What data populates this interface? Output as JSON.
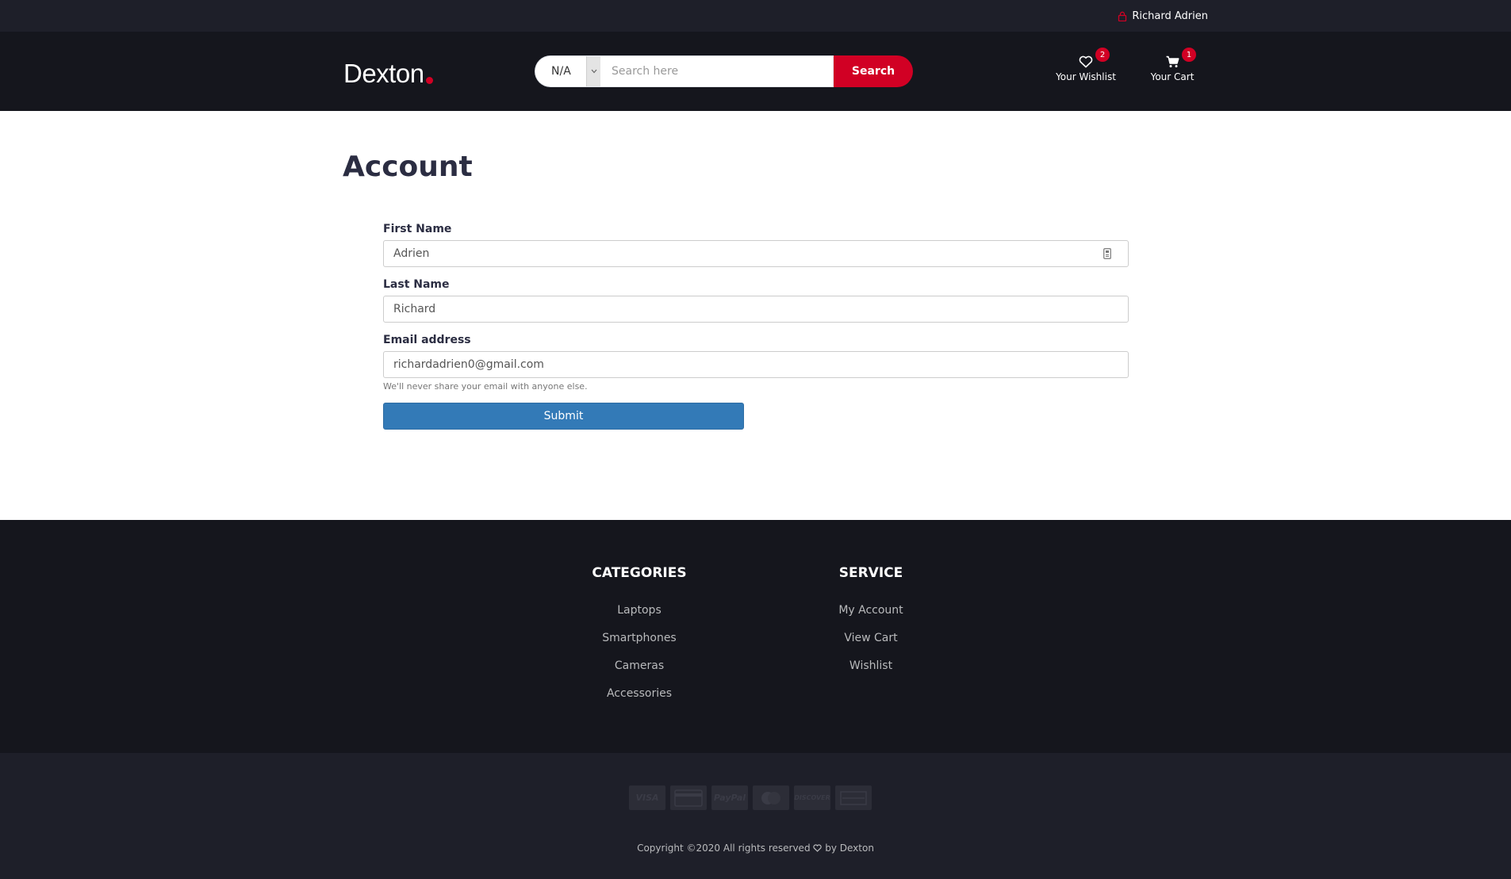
{
  "topbar": {
    "user_name": "Richard Adrien"
  },
  "header": {
    "logo": "Dexton",
    "search": {
      "category_value": "N/A",
      "placeholder": "Search here",
      "button_label": "Search"
    },
    "wishlist": {
      "label": "Your Wishlist",
      "count": "2"
    },
    "cart": {
      "label": "Your Cart",
      "count": "1"
    }
  },
  "main": {
    "title": "Account",
    "form": {
      "first_name_label": "First Name",
      "first_name_value": "Adrien",
      "last_name_label": "Last Name",
      "last_name_value": "Richard",
      "email_label": "Email address",
      "email_value": "richardadrien0@gmail.com",
      "email_help": "We'll never share your email with anyone else.",
      "submit_label": "Submit"
    }
  },
  "footer": {
    "categories": {
      "title": "CATEGORIES",
      "items": [
        "Laptops",
        "Smartphones",
        "Cameras",
        "Accessories"
      ]
    },
    "service": {
      "title": "SERVICE",
      "items": [
        "My Account",
        "View Cart",
        "Wishlist"
      ]
    }
  },
  "bottom": {
    "payment_methods": [
      "VISA",
      "credit-card",
      "PayPal",
      "mastercard",
      "DISCOVER",
      "amex"
    ],
    "copyright_prefix": "Copyright ©2020 All rights reserved",
    "copyright_suffix": "by Dexton"
  },
  "colors": {
    "brand_red": "#d10024",
    "header_dark": "#15161d",
    "topbar_dark": "#1e1f29",
    "submit_blue": "#337ab7"
  }
}
